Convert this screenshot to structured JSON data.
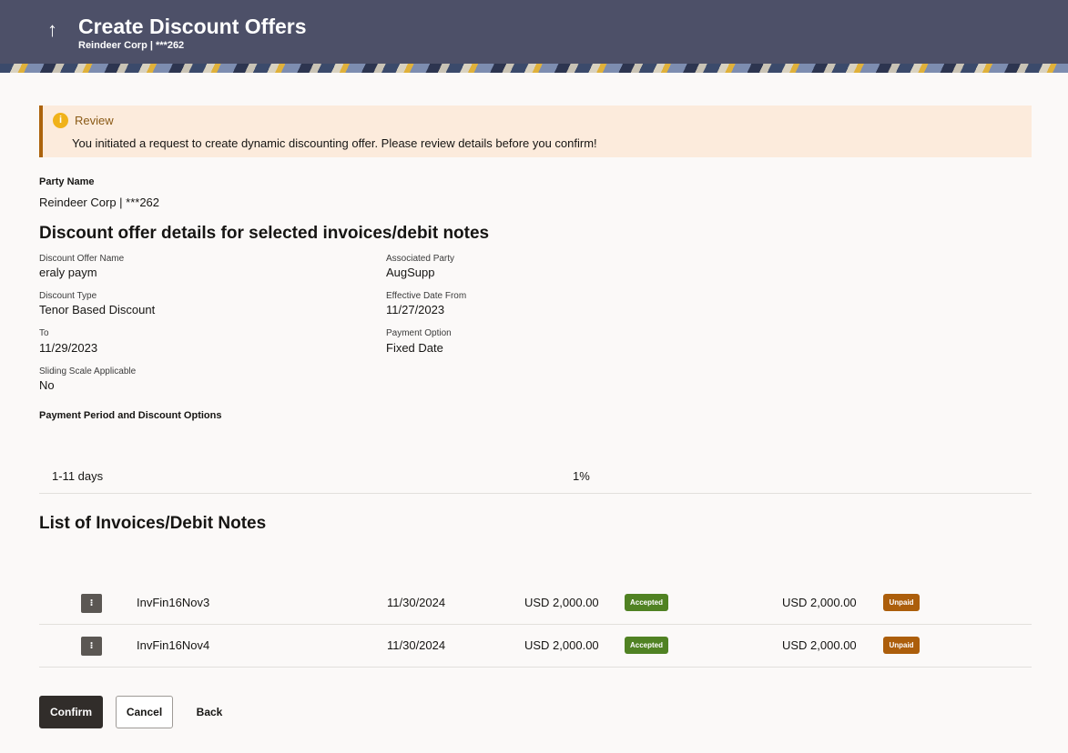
{
  "header": {
    "back_glyph": "↑",
    "title": "Create Discount Offers",
    "subtitle": "Reindeer Corp | ***262"
  },
  "alert": {
    "icon": "info-icon",
    "icon_glyph": "i",
    "heading": "Review",
    "message": "You initiated a request to create dynamic discounting offer. Please review details before you confirm!"
  },
  "party": {
    "label": "Party Name",
    "value": "Reindeer Corp | ***262"
  },
  "offer_section_title": "Discount offer details for selected invoices/debit notes",
  "details": {
    "offer_name_label": "Discount Offer Name",
    "offer_name_value": "eraly paym",
    "associated_party_label": "Associated Party",
    "associated_party_value": "AugSupp",
    "discount_type_label": "Discount Type",
    "discount_type_value": "Tenor Based Discount",
    "effective_from_label": "Effective Date From",
    "effective_from_value": "11/27/2023",
    "to_label": "To",
    "to_value": "11/29/2023",
    "payment_option_label": "Payment Option",
    "payment_option_value": "Fixed Date",
    "sliding_label": "Sliding Scale Applicable",
    "sliding_value": "No"
  },
  "payment_period": {
    "label": "Payment Period and Discount Options",
    "rows": [
      {
        "period": "1-11 days",
        "discount": "1%"
      }
    ]
  },
  "invoices": {
    "title": "List of Invoices/Debit Notes",
    "menu_glyph": "⁝",
    "rows": [
      {
        "id": "InvFin16Nov3",
        "due_date": "11/30/2024",
        "amount": "USD 2,000.00",
        "acceptance": "Accepted",
        "outstanding": "USD 2,000.00",
        "payment_status": "Unpaid"
      },
      {
        "id": "InvFin16Nov4",
        "due_date": "11/30/2024",
        "amount": "USD 2,000.00",
        "acceptance": "Accepted",
        "outstanding": "USD 2,000.00",
        "payment_status": "Unpaid"
      }
    ]
  },
  "actions": {
    "confirm": "Confirm",
    "cancel": "Cancel",
    "back": "Back"
  },
  "colors": {
    "header_bg": "#4d5068",
    "alert_bg": "#fcebdc",
    "alert_border": "#ac630c",
    "accepted": "#508223",
    "unpaid": "#ac5e0b",
    "primary_button": "#312d2a"
  }
}
